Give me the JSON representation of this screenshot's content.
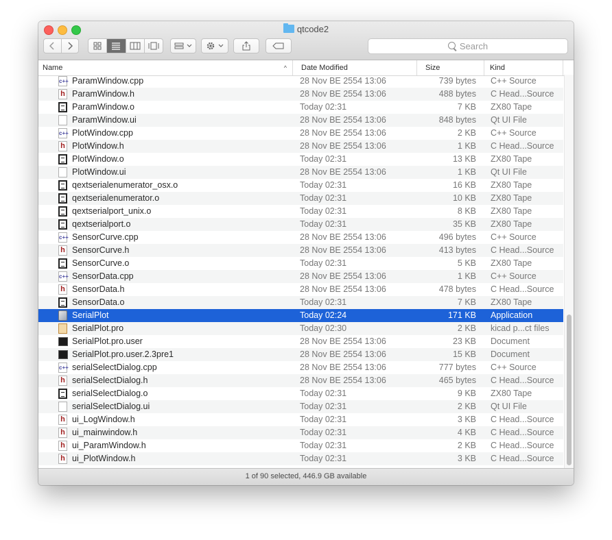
{
  "window": {
    "title": "qtcode2"
  },
  "toolbar": {
    "back_icon": "chevron-left-icon",
    "forward_icon": "chevron-right-icon"
  },
  "search": {
    "placeholder": "Search"
  },
  "columns": {
    "name": "Name",
    "date": "Date Modified",
    "size": "Size",
    "kind": "Kind"
  },
  "files": [
    {
      "name": "ParamWindow.cpp",
      "date": "28 Nov BE 2554 13:06",
      "size": "739 bytes",
      "kind": "C++ Source",
      "icon": "cpp"
    },
    {
      "name": "ParamWindow.h",
      "date": "28 Nov BE 2554 13:06",
      "size": "488 bytes",
      "kind": "C Head...Source",
      "icon": "h"
    },
    {
      "name": "ParamWindow.o",
      "date": "Today 02:31",
      "size": "7 KB",
      "kind": "ZX80 Tape",
      "icon": "obj"
    },
    {
      "name": "ParamWindow.ui",
      "date": "28 Nov BE 2554 13:06",
      "size": "848 bytes",
      "kind": "Qt UI File",
      "icon": "doc"
    },
    {
      "name": "PlotWindow.cpp",
      "date": "28 Nov BE 2554 13:06",
      "size": "2 KB",
      "kind": "C++ Source",
      "icon": "cpp"
    },
    {
      "name": "PlotWindow.h",
      "date": "28 Nov BE 2554 13:06",
      "size": "1 KB",
      "kind": "C Head...Source",
      "icon": "h"
    },
    {
      "name": "PlotWindow.o",
      "date": "Today 02:31",
      "size": "13 KB",
      "kind": "ZX80 Tape",
      "icon": "obj"
    },
    {
      "name": "PlotWindow.ui",
      "date": "28 Nov BE 2554 13:06",
      "size": "1 KB",
      "kind": "Qt UI File",
      "icon": "doc"
    },
    {
      "name": "qextserialenumerator_osx.o",
      "date": "Today 02:31",
      "size": "16 KB",
      "kind": "ZX80 Tape",
      "icon": "obj"
    },
    {
      "name": "qextserialenumerator.o",
      "date": "Today 02:31",
      "size": "10 KB",
      "kind": "ZX80 Tape",
      "icon": "obj"
    },
    {
      "name": "qextserialport_unix.o",
      "date": "Today 02:31",
      "size": "8 KB",
      "kind": "ZX80 Tape",
      "icon": "obj"
    },
    {
      "name": "qextserialport.o",
      "date": "Today 02:31",
      "size": "35 KB",
      "kind": "ZX80 Tape",
      "icon": "obj"
    },
    {
      "name": "SensorCurve.cpp",
      "date": "28 Nov BE 2554 13:06",
      "size": "496 bytes",
      "kind": "C++ Source",
      "icon": "cpp"
    },
    {
      "name": "SensorCurve.h",
      "date": "28 Nov BE 2554 13:06",
      "size": "413 bytes",
      "kind": "C Head...Source",
      "icon": "h"
    },
    {
      "name": "SensorCurve.o",
      "date": "Today 02:31",
      "size": "5 KB",
      "kind": "ZX80 Tape",
      "icon": "obj"
    },
    {
      "name": "SensorData.cpp",
      "date": "28 Nov BE 2554 13:06",
      "size": "1 KB",
      "kind": "C++ Source",
      "icon": "cpp"
    },
    {
      "name": "SensorData.h",
      "date": "28 Nov BE 2554 13:06",
      "size": "478 bytes",
      "kind": "C Head...Source",
      "icon": "h"
    },
    {
      "name": "SensorData.o",
      "date": "Today 02:31",
      "size": "7 KB",
      "kind": "ZX80 Tape",
      "icon": "obj"
    },
    {
      "name": "SerialPlot",
      "date": "Today 02:24",
      "size": "171 KB",
      "kind": "Application",
      "icon": "app",
      "selected": true
    },
    {
      "name": "SerialPlot.pro",
      "date": "Today 02:30",
      "size": "2 KB",
      "kind": "kicad p...ct files",
      "icon": "pro"
    },
    {
      "name": "SerialPlot.pro.user",
      "date": "28 Nov BE 2554 13:06",
      "size": "23 KB",
      "kind": "Document",
      "icon": "term"
    },
    {
      "name": "SerialPlot.pro.user.2.3pre1",
      "date": "28 Nov BE 2554 13:06",
      "size": "15 KB",
      "kind": "Document",
      "icon": "term"
    },
    {
      "name": "serialSelectDialog.cpp",
      "date": "28 Nov BE 2554 13:06",
      "size": "777 bytes",
      "kind": "C++ Source",
      "icon": "cpp"
    },
    {
      "name": "serialSelectDialog.h",
      "date": "28 Nov BE 2554 13:06",
      "size": "465 bytes",
      "kind": "C Head...Source",
      "icon": "h"
    },
    {
      "name": "serialSelectDialog.o",
      "date": "Today 02:31",
      "size": "9 KB",
      "kind": "ZX80 Tape",
      "icon": "obj"
    },
    {
      "name": "serialSelectDialog.ui",
      "date": "Today 02:31",
      "size": "2 KB",
      "kind": "Qt UI File",
      "icon": "doc"
    },
    {
      "name": "ui_LogWindow.h",
      "date": "Today 02:31",
      "size": "3 KB",
      "kind": "C Head...Source",
      "icon": "h"
    },
    {
      "name": "ui_mainwindow.h",
      "date": "Today 02:31",
      "size": "4 KB",
      "kind": "C Head...Source",
      "icon": "h"
    },
    {
      "name": "ui_ParamWindow.h",
      "date": "Today 02:31",
      "size": "2 KB",
      "kind": "C Head...Source",
      "icon": "h"
    },
    {
      "name": "ui_PlotWindow.h",
      "date": "Today 02:31",
      "size": "3 KB",
      "kind": "C Head...Source",
      "icon": "h"
    }
  ],
  "status": {
    "text": "1 of 90 selected, 446.9 GB available"
  },
  "colors": {
    "selection": "#1d62d8",
    "close": "#fc605c",
    "minimize": "#fdbc40",
    "zoom": "#34c84a"
  }
}
